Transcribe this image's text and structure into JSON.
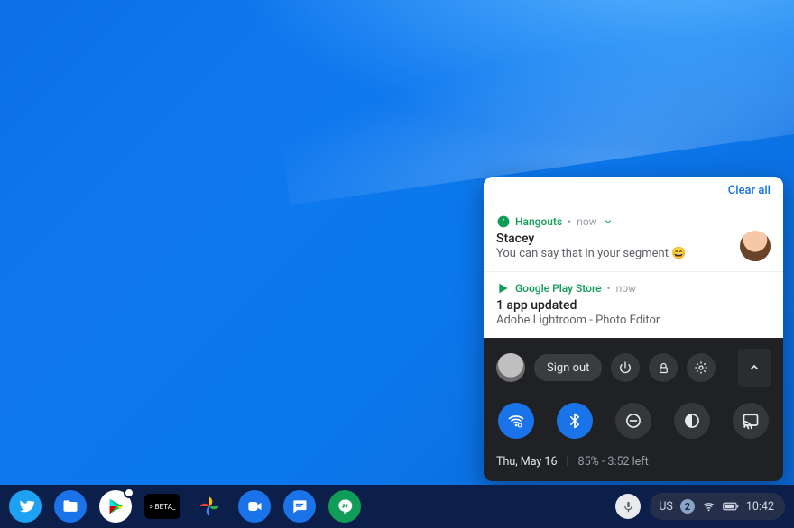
{
  "panel": {
    "clear_all": "Clear all",
    "notifications": [
      {
        "app": "Hangouts",
        "time": "now",
        "expandable": true,
        "title": "Stacey",
        "body": "You can say that in your segment 😄",
        "has_avatar": true
      },
      {
        "app": "Google Play Store",
        "time": "now",
        "expandable": false,
        "title": "1 app updated",
        "body": "Adobe Lightroom - Photo Editor",
        "has_avatar": false
      }
    ],
    "signout": "Sign out",
    "date": "Thu, May 16",
    "battery": "85% - 3:52 left"
  },
  "shelf": {
    "beta_label": "> BETA_",
    "notif_count": "2",
    "ime": "US",
    "clock": "10:42"
  }
}
